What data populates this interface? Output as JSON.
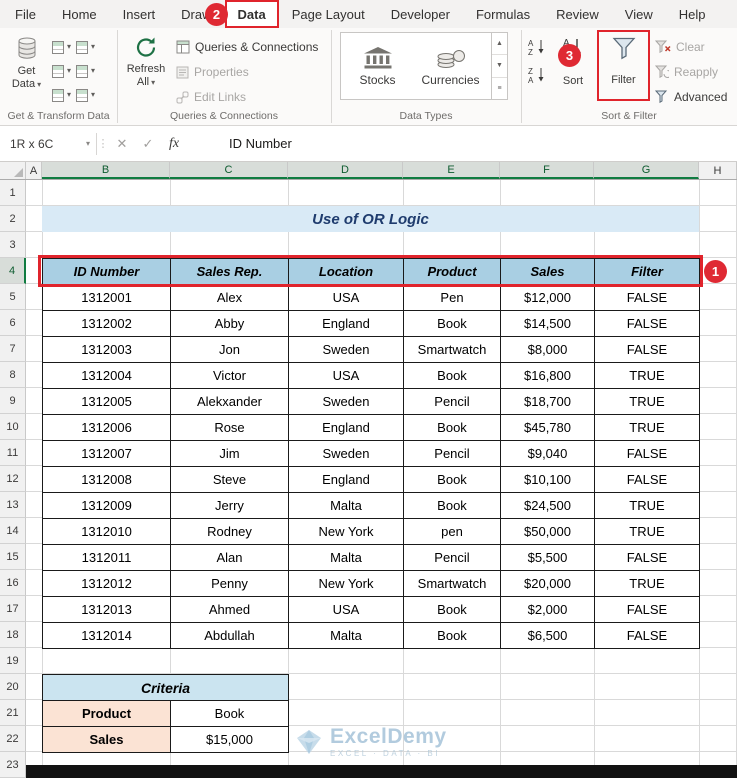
{
  "ribbon": {
    "tabs": [
      "File",
      "Home",
      "Insert",
      "Draw",
      "Data",
      "Page Layout",
      "Developer",
      "Formulas",
      "Review",
      "View",
      "Help"
    ],
    "active_tab": "Data",
    "buttons": {
      "get_data": "Get Data",
      "refresh_all": "Refresh All",
      "queries_connections": "Queries & Connections",
      "properties": "Properties",
      "edit_links": "Edit Links",
      "stocks": "Stocks",
      "currencies": "Currencies",
      "sort": "Sort",
      "filter": "Filter",
      "clear": "Clear",
      "reapply": "Reapply",
      "advanced": "Advanced"
    },
    "group_labels": [
      "Get & Transform Data",
      "Queries & Connections",
      "Data Types",
      "Sort & Filter"
    ]
  },
  "formula_bar": {
    "name_box": "1R x 6C",
    "formula": "ID Number"
  },
  "sheet": {
    "columns": [
      "A",
      "B",
      "C",
      "D",
      "E",
      "F",
      "G",
      "H"
    ],
    "selected_columns": [
      "B",
      "C",
      "D",
      "E",
      "F",
      "G"
    ],
    "row_count": 23,
    "selected_row": 4
  },
  "title_cell": {
    "text": "Use of OR Logic"
  },
  "table": {
    "headers": [
      "ID Number",
      "Sales Rep.",
      "Location",
      "Product",
      "Sales",
      "Filter"
    ],
    "rows": [
      [
        "1312001",
        "Alex",
        "USA",
        "Pen",
        "$12,000",
        "FALSE"
      ],
      [
        "1312002",
        "Abby",
        "England",
        "Book",
        "$14,500",
        "FALSE"
      ],
      [
        "1312003",
        "Jon",
        "Sweden",
        "Smartwatch",
        "$8,000",
        "FALSE"
      ],
      [
        "1312004",
        "Victor",
        "USA",
        "Book",
        "$16,800",
        "TRUE"
      ],
      [
        "1312005",
        "Alekxander",
        "Sweden",
        "Pencil",
        "$18,700",
        "TRUE"
      ],
      [
        "1312006",
        "Rose",
        "England",
        "Book",
        "$45,780",
        "TRUE"
      ],
      [
        "1312007",
        "Jim",
        "Sweden",
        "Pencil",
        "$9,040",
        "FALSE"
      ],
      [
        "1312008",
        "Steve",
        "England",
        "Book",
        "$10,100",
        "FALSE"
      ],
      [
        "1312009",
        "Jerry",
        "Malta",
        "Book",
        "$24,500",
        "TRUE"
      ],
      [
        "1312010",
        "Rodney",
        "New York",
        "pen",
        "$50,000",
        "TRUE"
      ],
      [
        "1312011",
        "Alan",
        "Malta",
        "Pencil",
        "$5,500",
        "FALSE"
      ],
      [
        "1312012",
        "Penny",
        "New York",
        "Smartwatch",
        "$20,000",
        "TRUE"
      ],
      [
        "1312013",
        "Ahmed",
        "USA",
        "Book",
        "$2,000",
        "FALSE"
      ],
      [
        "1312014",
        "Abdullah",
        "Malta",
        "Book",
        "$6,500",
        "FALSE"
      ]
    ]
  },
  "criteria": {
    "title": "Criteria",
    "rows": [
      [
        "Product",
        "Book"
      ],
      [
        "Sales",
        "$15,000"
      ]
    ]
  },
  "annotations": {
    "badge1": "1",
    "badge2": "2",
    "badge3": "3"
  },
  "watermark": {
    "name": "ExcelDemy",
    "tagline": "EXCEL · DATA · BI"
  },
  "colors": {
    "annotation_red": "#E0242C",
    "header_blue": "#A9CFE3",
    "title_blue": "#D9EAF6",
    "criteria_blue": "#CBE4F0",
    "label_peach": "#FBE3D4",
    "excel_green": "#107C41"
  }
}
